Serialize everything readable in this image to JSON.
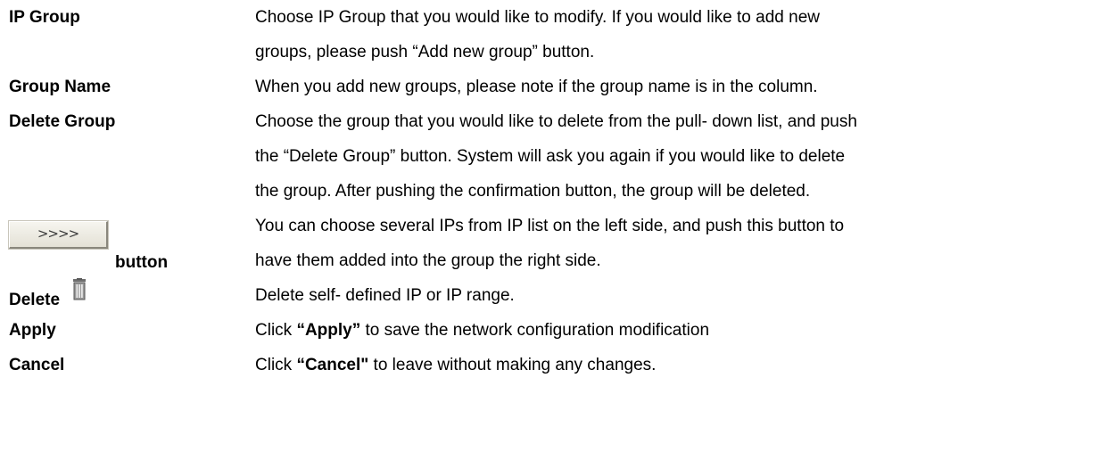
{
  "definitions": [
    {
      "term": "IP Group",
      "lines": [
        "Choose IP Group that you would like to modify. If you would like to add new",
        "groups, please push “Add new group” button."
      ]
    },
    {
      "term": "Group Name",
      "lines": [
        "When you add new groups, please note if the group name is in the column."
      ]
    },
    {
      "term": "Delete Group",
      "lines": [
        "Choose the group that you would like to delete from the pull- down list, and push",
        "the “Delete Group” button. System will ask you again if you would like to delete",
        "the group. After pushing the confirmation button, the group will be deleted."
      ]
    },
    {
      "term_button_label": ">>>>",
      "term": "button",
      "lines": [
        "You can choose several IPs from IP list on the left side, and push this button to",
        "have them added into the group the right side."
      ]
    },
    {
      "term": "Delete",
      "term_icon": "trash-icon",
      "lines": [
        "Delete self- defined IP or IP range."
      ]
    },
    {
      "term": "Apply",
      "desc_prefix": "Click ",
      "desc_bold": "“Apply”",
      "desc_suffix": " to save the network configuration modification"
    },
    {
      "term": "Cancel",
      "desc_prefix": "Click ",
      "desc_bold": "“Cancel\"",
      "desc_suffix": " to leave without making any changes."
    }
  ]
}
